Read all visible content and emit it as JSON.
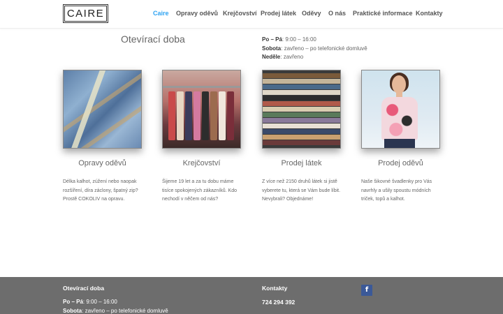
{
  "logo": {
    "text": "CAIRE"
  },
  "nav": {
    "items": [
      {
        "label": "Caire",
        "active": true
      },
      {
        "label": "Opravy oděvů"
      },
      {
        "label": "Krejčovství"
      },
      {
        "label": "Prodej látek"
      },
      {
        "label": "Oděvy"
      },
      {
        "label": "O nás"
      },
      {
        "label": "Praktické informace"
      },
      {
        "label": "Kontakty"
      }
    ],
    "active_color": "#2ea3f2"
  },
  "opening": {
    "title": "Otevírací doba",
    "rows": [
      {
        "day": "Po – Pá",
        "sep": ": ",
        "value": "9:00 – 16:00"
      },
      {
        "day": "Sobota",
        "sep": ": ",
        "value": "zavřeno – po telefonické domluvě"
      },
      {
        "day": "Neděle",
        "sep": ": ",
        "value": "zavřeno"
      }
    ]
  },
  "cards": [
    {
      "title": "Opravy oděvů",
      "image": "jeans-repair-photo",
      "text": "Délka kalhot, zúžení nebo naopak rozšíření, díra záclony, špatný zip? Prostě COKOLIV na opravu."
    },
    {
      "title": "Krejčovství",
      "image": "clothing-rack-photo",
      "text": "Šijeme 19 let a za tu dobu máme tisíce spokojených zákazníků. Kdo nechodí v něčem od nás?"
    },
    {
      "title": "Prodej látek",
      "image": "fabric-rolls-photo",
      "text": "Z více než 2150 druhů látek si jistě vyberete tu, která se Vám bude líbit. Nevybrali? Objednáme!"
    },
    {
      "title": "Prodej oděvů",
      "image": "woman-in-tshirt-photo",
      "text": "Naše šikovné švadlenky pro Vás navrhly a ušily spoustu módních triček, topů a kalhot."
    }
  ],
  "footer": {
    "hours_title": "Otevírací doba",
    "rows": [
      {
        "day": "Po – Pá",
        "sep": ": ",
        "value": "9:00 – 16:00"
      },
      {
        "day": "Sobota",
        "sep": ": ",
        "value": "zavřeno – po telefonické domluvě"
      }
    ],
    "contacts_title": "Kontakty",
    "phone": "724 294 392",
    "social_icon": "facebook-icon",
    "background": "#6d6d6d"
  }
}
